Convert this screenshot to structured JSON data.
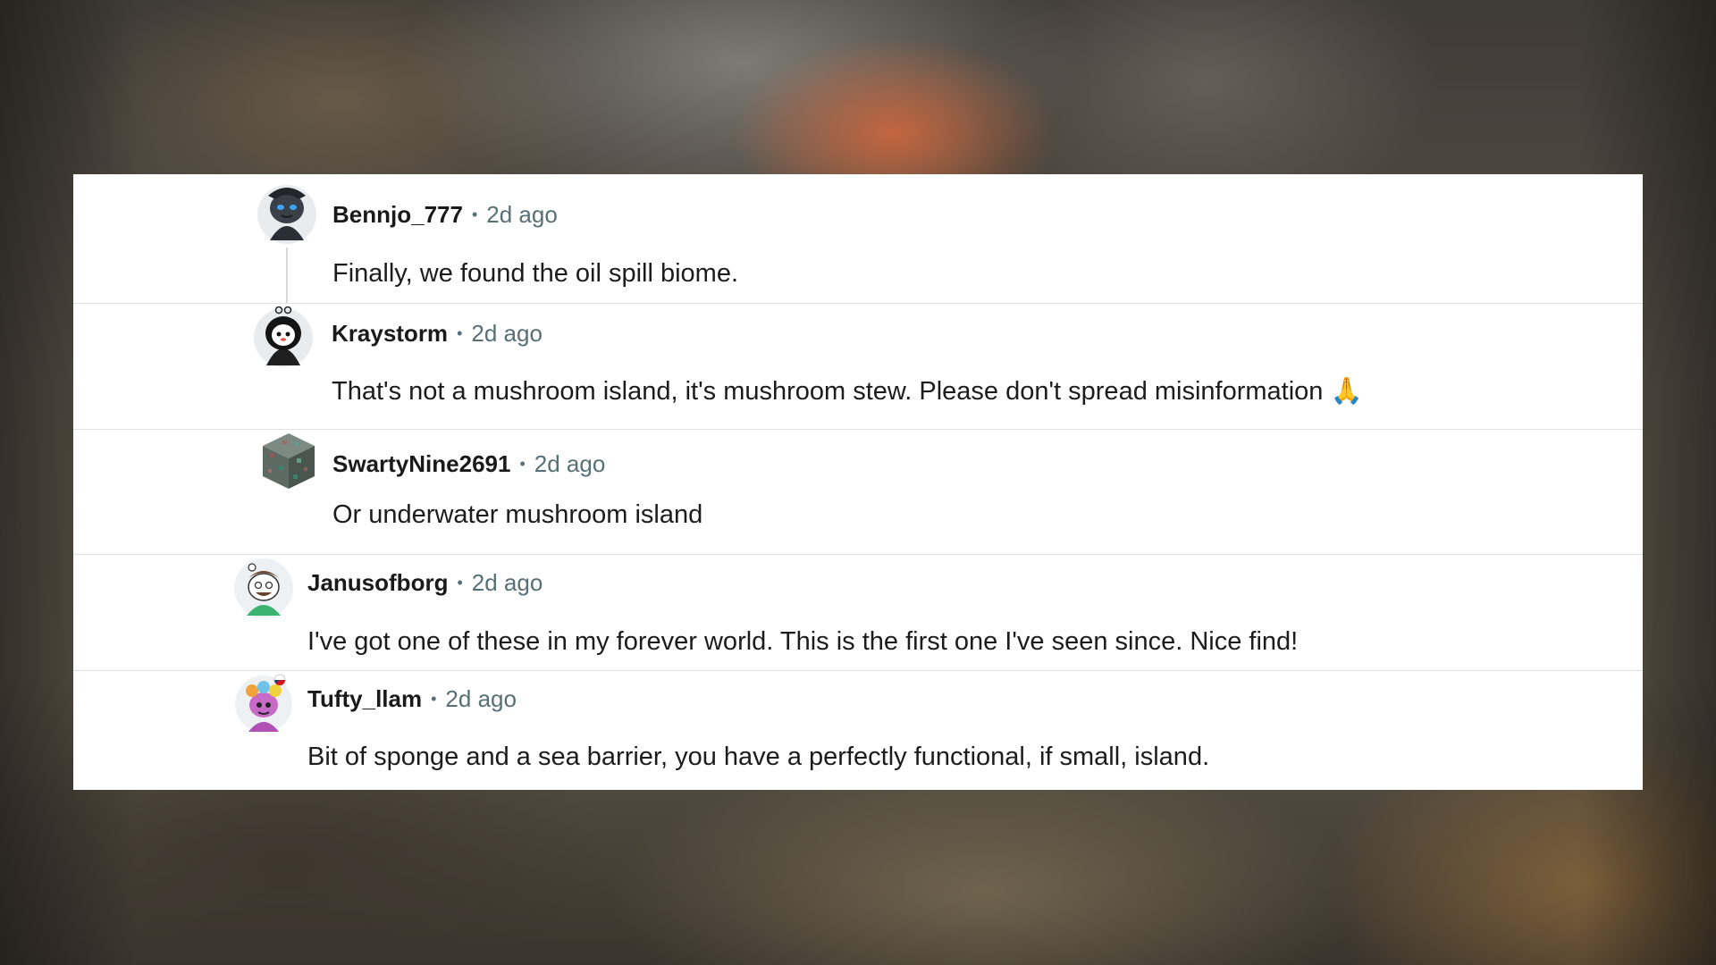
{
  "comments": [
    {
      "username": "Bennjo_777",
      "separator": "•",
      "time": "2d ago",
      "text": "Finally, we found the oil spill biome.",
      "avatar_icon": "snoo-hooded-dark-avatar"
    },
    {
      "username": "Kraystorm",
      "separator": "•",
      "time": "2d ago",
      "text": "That's not a mushroom island, it's mushroom stew. Please don't spread misinformation 🙏",
      "avatar_icon": "snoo-black-cloak-avatar"
    },
    {
      "username": "SwartyNine2691",
      "separator": "•",
      "time": "2d ago",
      "text": "Or underwater mushroom island",
      "avatar_icon": "minecraft-block-avatar"
    },
    {
      "username": "Janusofborg",
      "separator": "•",
      "time": "2d ago",
      "text": "I've got one of these in my forever world. This is the first one I've seen since. Nice find!",
      "avatar_icon": "snoo-green-shirt-avatar"
    },
    {
      "username": "Tufty_llam",
      "separator": "•",
      "time": "2d ago",
      "text": "Bit of sponge and a sea barrier, you have a perfectly functional, if small, island.",
      "avatar_icon": "snoo-pink-costume-avatar"
    }
  ],
  "colors": {
    "panel_background": "#ffffff",
    "username": "#1a1a1b",
    "meta": "#576f76",
    "body_text": "#1c1c1c",
    "divider": "#dfe3e6"
  }
}
